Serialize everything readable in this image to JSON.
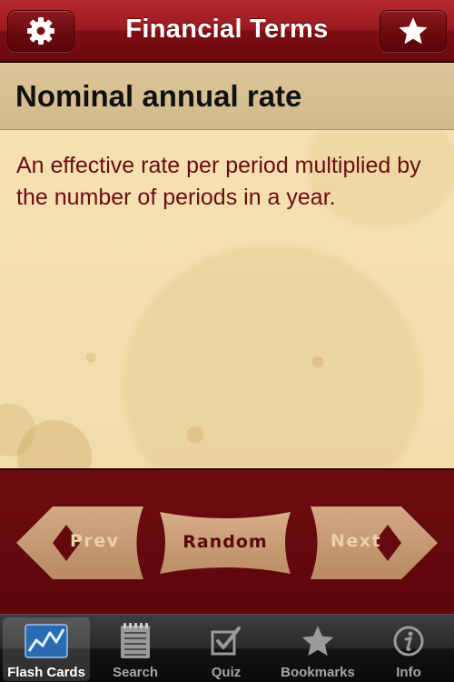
{
  "navbar": {
    "title": "Financial Terms",
    "left_icon": "gear-icon",
    "right_icon": "star-icon"
  },
  "term": {
    "title": "Nominal annual rate",
    "definition": "An effective rate per period multiplied by the number of periods in a year."
  },
  "controls": {
    "prev_label": "Prev",
    "random_label": "Random",
    "next_label": "Next"
  },
  "tabs": [
    {
      "label": "Flash Cards",
      "icon": "chart-icon",
      "active": true
    },
    {
      "label": "Search",
      "icon": "notepad-icon",
      "active": false
    },
    {
      "label": "Quiz",
      "icon": "checkbox-icon",
      "active": false
    },
    {
      "label": "Bookmarks",
      "icon": "star-icon",
      "active": false
    },
    {
      "label": "Info",
      "icon": "info-icon",
      "active": false
    }
  ],
  "colors": {
    "navbar": "#9b1a1f",
    "term_header": "#d8c090",
    "parchment": "#f4e1b2",
    "definition_text": "#6a0d10",
    "controls_bg": "#650a0e",
    "button_tan": "#c79c76"
  }
}
